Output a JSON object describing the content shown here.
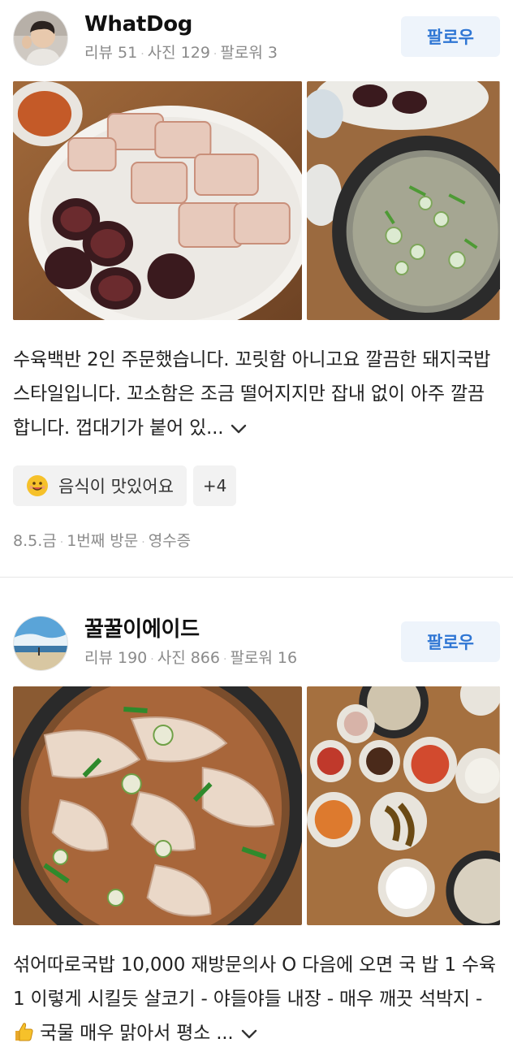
{
  "reviews": [
    {
      "author": {
        "name": "WhatDog",
        "stats": [
          "리뷰 51",
          "사진 129",
          "팔로워 3"
        ]
      },
      "follow_label": "팔로우",
      "photos": [
        "bossam-platter-photo",
        "clear-soup-photo"
      ],
      "text": "수육백반 2인 주문했습니다. 꼬릿함 아니고요 깔끔한 돼지국밥 스타일입니다. 꼬소함은 조금 떨어지지만 잡내 없이 아주 깔끔합니다. 껍대기가 붙어 있...",
      "tag": "음식이 맛있어요",
      "tag_more": "+4",
      "meta": [
        "8.5.금",
        "1번째 방문",
        "영수증"
      ]
    },
    {
      "author": {
        "name": "꿀꿀이에이드",
        "stats": [
          "리뷰 190",
          "사진 866",
          "팔로워 16"
        ]
      },
      "follow_label": "팔로우",
      "photos": [
        "pork-soup-photo",
        "side-dishes-photo"
      ],
      "text_before_emoji": "섞어따로국밥 10,000 재방문의사 O 다음에 오면 국 밥 1 수육1 이렇게 시킬듯 살코기 - 야들야들 내장 - 매우 깨끗 석박지 - ",
      "text_after_emoji": " 국물 매우 맑아서 평소 ..."
    }
  ],
  "colors": {
    "accent": "#2f76d4",
    "follow_bg": "#eef4fb",
    "muted": "#8a8a8a"
  },
  "icons": [
    "chevron-down-icon",
    "smiley-emoji-icon",
    "thumbs-up-emoji-icon"
  ]
}
